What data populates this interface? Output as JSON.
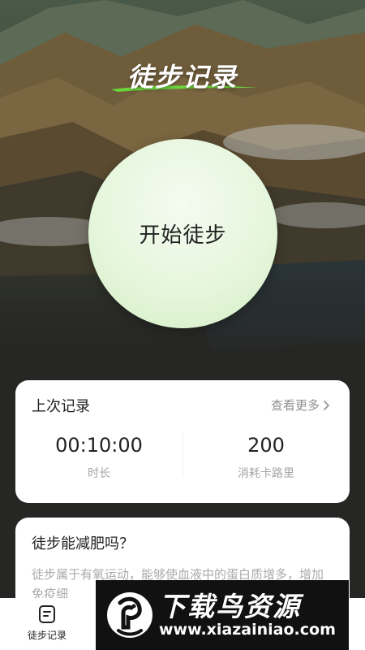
{
  "header": {
    "title": "徒步记录"
  },
  "start_button": {
    "label": "开始徒步"
  },
  "last_record": {
    "title": "上次记录",
    "more_label": "查看更多",
    "duration_value": "00:10:00",
    "duration_label": "时长",
    "calories_value": "200",
    "calories_label": "消耗卡路里"
  },
  "article": {
    "title": "徒步能减肥吗？",
    "body": "徒步属于有氧运动，能够使血液中的蛋白质增多，增加免疫细"
  },
  "bottom_nav": {
    "items": [
      {
        "label": "徒步记录",
        "icon": "document-icon"
      }
    ]
  },
  "watermark": {
    "title": "下载鸟资源",
    "url": "www.xiazainiao.com"
  },
  "colors": {
    "accent_green": "#6bd63c",
    "start_circle": "#e6f6dd",
    "background": "#262624"
  }
}
